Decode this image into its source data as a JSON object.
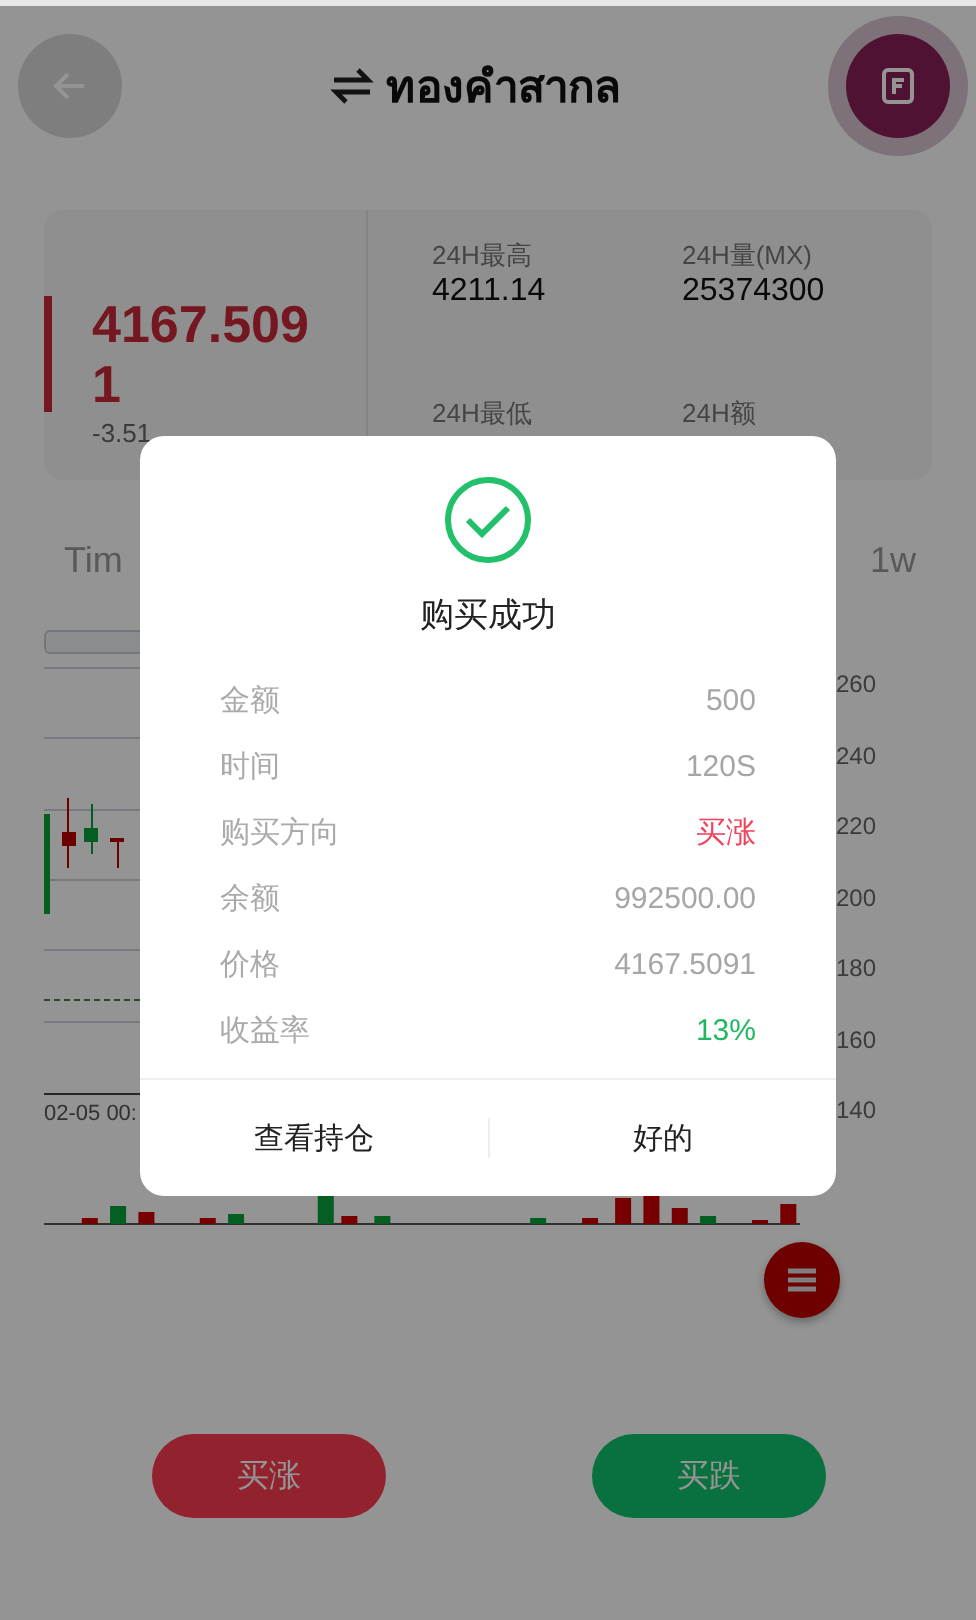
{
  "header": {
    "title": "ทองคำสากล"
  },
  "quote": {
    "price": "4167.5091",
    "change": "-3.51",
    "stats": [
      {
        "label": "24H最高",
        "value": "4211.14"
      },
      {
        "label": "24H量(MX)",
        "value": "25374300"
      },
      {
        "label": "24H最低"
      },
      {
        "label": "24H额"
      }
    ]
  },
  "tabs": [
    {
      "label": "Tim",
      "selected": false
    },
    {
      "label": "1w",
      "selected": false
    }
  ],
  "chart": {
    "y_axis_labels": [
      "260",
      "240",
      "220",
      "200",
      "180",
      "160",
      "140"
    ],
    "x_axis_label": "02-05 00:"
  },
  "dialog": {
    "title": "购买成功",
    "rows": [
      {
        "label": "金额",
        "value": "500",
        "color": "#a6a6a6"
      },
      {
        "label": "时间",
        "value": "120S",
        "color": "#a6a6a6"
      },
      {
        "label": "购买方向",
        "value": "买涨",
        "color": "#f0425a"
      },
      {
        "label": "余额",
        "value": "992500.00",
        "color": "#a6a6a6"
      },
      {
        "label": "价格",
        "value": "4167.5091",
        "color": "#a6a6a6"
      },
      {
        "label": "收益率",
        "value": "13%",
        "color": "#1fb862"
      }
    ],
    "buttons": [
      "查看持仓",
      "好的"
    ]
  },
  "actions": [
    "买涨",
    "买跌"
  ]
}
